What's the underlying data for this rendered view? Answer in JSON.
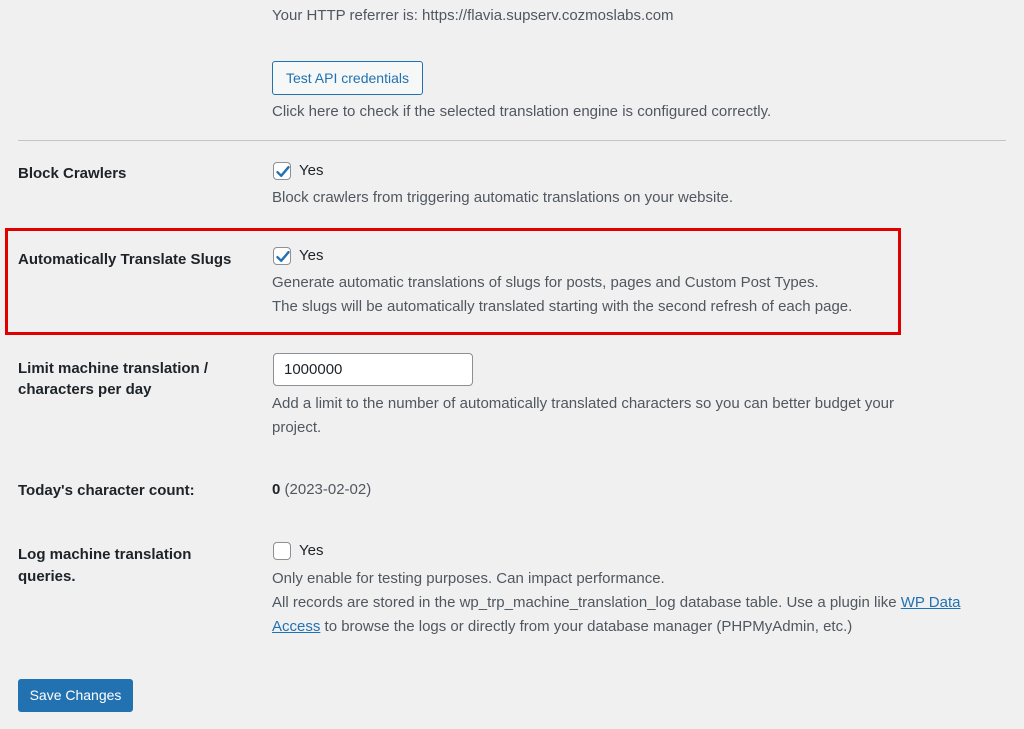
{
  "api": {
    "referrer_text": "Your HTTP referrer is: https://flavia.supserv.cozmoslabs.com",
    "test_button_label": "Test API credentials",
    "test_description": "Click here to check if the selected translation engine is configured correctly."
  },
  "block_crawlers": {
    "label": "Block Crawlers",
    "checkbox_label": "Yes",
    "checked": true,
    "description": "Block crawlers from triggering automatic translations on your website."
  },
  "translate_slugs": {
    "label": "Automatically Translate Slugs",
    "checkbox_label": "Yes",
    "checked": true,
    "description_line1": "Generate automatic translations of slugs for posts, pages and Custom Post Types.",
    "description_line2": "The slugs will be automatically translated starting with the second refresh of each page.",
    "highlight_color": "#e00000"
  },
  "limit": {
    "label_line1": "Limit machine translation /",
    "label_line2": "characters per day",
    "value": "1000000",
    "description_line1": "Add a limit to the number of automatically translated characters so you can better budget your",
    "description_line2": "project."
  },
  "char_count": {
    "label": "Today's character count:",
    "count": "0",
    "date": "(2023-02-02)"
  },
  "log_queries": {
    "label_line1": "Log machine translation",
    "label_line2": "queries.",
    "checkbox_label": "Yes",
    "checked": false,
    "description_line1": "Only enable for testing purposes. Can impact performance.",
    "description_line2_prefix": "All records are stored in the wp_trp_machine_translation_log database table. Use a plugin like ",
    "link_part1": "WP Data",
    "link_part2": "Access",
    "description_line3_suffix": " to browse the logs or directly from your database manager (PHPMyAdmin, etc.)"
  },
  "footer": {
    "save_label": "Save Changes"
  },
  "colors": {
    "accent": "#2271b1",
    "background": "#f0f0f1",
    "text": "#1d2327",
    "muted_text": "#50575e",
    "highlight": "#e00000"
  }
}
